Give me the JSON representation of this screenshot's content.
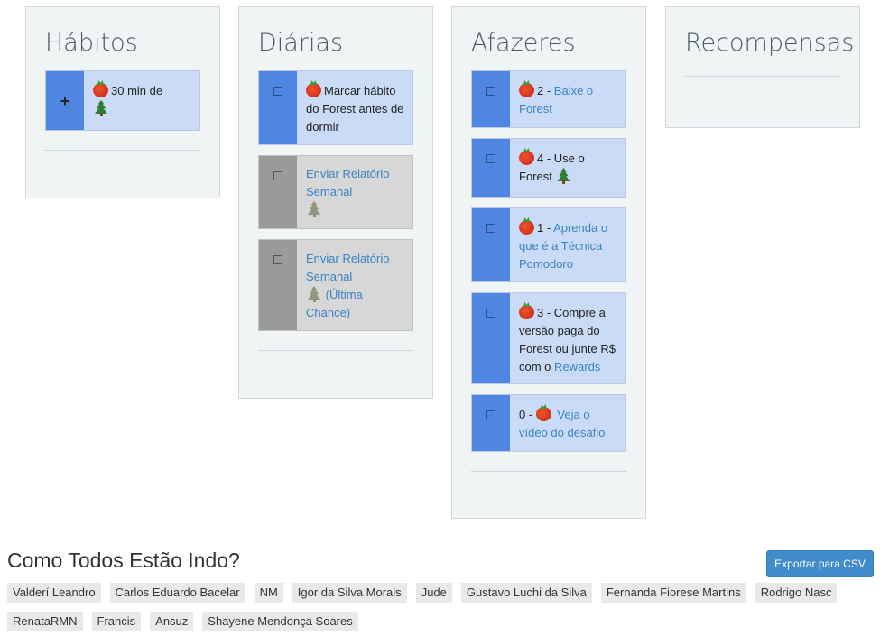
{
  "columns": {
    "habits": {
      "title": "Hábitos",
      "tasks": [
        {
          "text": "30 min de"
        }
      ]
    },
    "dailies": {
      "title": "Diárias",
      "tasks": [
        {
          "text_a": "Marcar hábito do Forest antes de dormir"
        },
        {
          "text_a": "Enviar Relatório Semanal"
        },
        {
          "text_a": "Enviar Relatório Semanal",
          "text_b": "(Última Chance)"
        }
      ]
    },
    "todos": {
      "title": "Afazeres",
      "tasks": [
        {
          "prefix": "2 - ",
          "link": "Baixe o Forest"
        },
        {
          "prefix": "4 - Use o Forest"
        },
        {
          "prefix": "1 - ",
          "link": "Aprenda o que é a Técnica Pomodoro"
        },
        {
          "prefix": "3 - Compre a versão paga do Forest ou junte R$ com o ",
          "link": "Rewards"
        },
        {
          "prefix": "0 - ",
          "link": "Veja o vídeo do desafio"
        }
      ]
    },
    "rewards": {
      "title": "Recompensas"
    }
  },
  "party": {
    "title": "Como Todos Estão Indo?",
    "export_label": "Exportar para CSV",
    "members": [
      "Valderí Leandro",
      "Carlos Eduardo Bacelar",
      "NM",
      "Igor da Silva Morais",
      "Jude",
      "Gustavo Luchi da Silva",
      "Fernanda Fiorese Martins",
      "Rodrigo Nasc",
      "RenataRMN",
      "Francis",
      "Ansuz",
      "Shayene Mendonça Soares"
    ]
  },
  "icons": {
    "tomato": "tomato-icon",
    "tree": "evergreen-tree-icon",
    "plus": "plus-icon",
    "checkbox": "checkbox-icon"
  },
  "colors": {
    "task_blue": "#c9dbf6",
    "handle_blue": "#4f86e2",
    "task_done": "#d7d7d7",
    "handle_done": "#9a9a9a",
    "link": "#3a83c5",
    "button": "#428bca"
  }
}
